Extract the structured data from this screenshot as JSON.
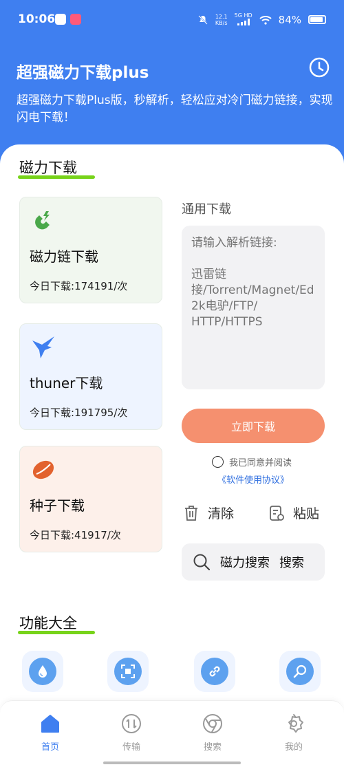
{
  "status": {
    "time": "10:06",
    "speed_value": "12.1",
    "speed_unit": "KB/s",
    "signal_label": "5G HD",
    "battery": "84%"
  },
  "header": {
    "title": "超强磁力下载plus",
    "subtitle": "超强磁力下载Plus版，秒解析，轻松应对冷门磁力链接，实现闪电下载！"
  },
  "sections": {
    "magnet": "磁力下载",
    "features": "功能大全"
  },
  "cards": [
    {
      "title": "磁力链下载",
      "stat": "今日下载:174191/次",
      "icon": "magnet-icon"
    },
    {
      "title": "thuner下载",
      "stat": "今日下载:191795/次",
      "icon": "thunder-bird-icon"
    },
    {
      "title": "种子下载",
      "stat": "今日下载:41917/次",
      "icon": "seed-icon"
    }
  ],
  "general": {
    "label": "通用下载",
    "placeholder": "请输入解析链接:\n\n迅雷链接/Torrent/Magnet/Ed2k电驴/FTP/\nHTTP/HTTPS",
    "download_button": "立即下载",
    "agree_text": "我已同意并阅读",
    "agreement_link": "《软件使用协议》",
    "clear_label": "清除",
    "paste_label": "粘贴",
    "search_label": "磁力搜索",
    "search_button": "搜索"
  },
  "features": [
    {
      "icon": "drop-icon"
    },
    {
      "icon": "qr-scan-icon"
    },
    {
      "icon": "link-icon"
    },
    {
      "icon": "magnifier-icon"
    }
  ],
  "nav": [
    {
      "label": "首页",
      "icon": "home-icon",
      "active": true
    },
    {
      "label": "传输",
      "icon": "transfer-icon"
    },
    {
      "label": "搜索",
      "icon": "browser-icon"
    },
    {
      "label": "我的",
      "icon": "gear-icon"
    }
  ],
  "colors": {
    "primary": "#3f7ff0",
    "accent_green": "#77d31a",
    "download_button": "#f5906f"
  }
}
